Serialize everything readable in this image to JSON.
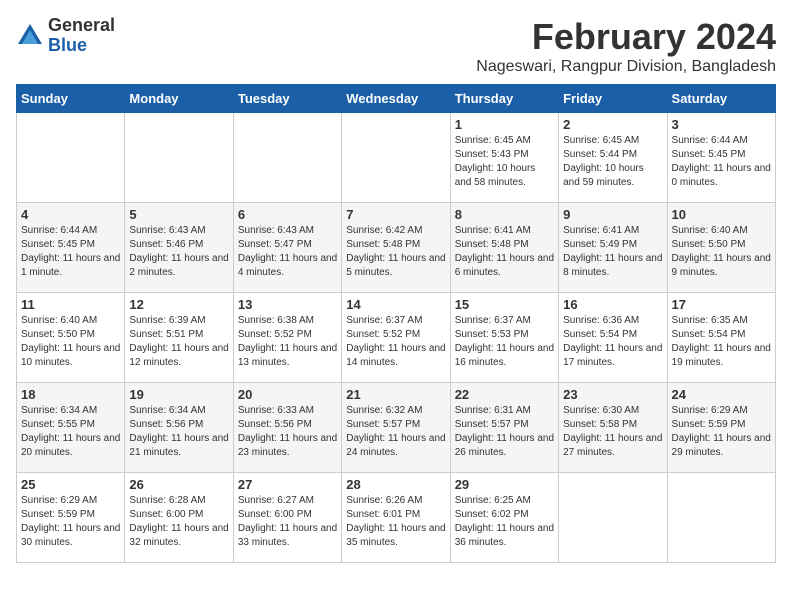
{
  "header": {
    "logo": {
      "general": "General",
      "blue": "Blue"
    },
    "title": "February 2024",
    "location": "Nageswari, Rangpur Division, Bangladesh"
  },
  "days_of_week": [
    "Sunday",
    "Monday",
    "Tuesday",
    "Wednesday",
    "Thursday",
    "Friday",
    "Saturday"
  ],
  "weeks": [
    [
      {
        "day": "",
        "info": ""
      },
      {
        "day": "",
        "info": ""
      },
      {
        "day": "",
        "info": ""
      },
      {
        "day": "",
        "info": ""
      },
      {
        "day": "1",
        "info": "Sunrise: 6:45 AM\nSunset: 5:43 PM\nDaylight: 10 hours and 58 minutes."
      },
      {
        "day": "2",
        "info": "Sunrise: 6:45 AM\nSunset: 5:44 PM\nDaylight: 10 hours and 59 minutes."
      },
      {
        "day": "3",
        "info": "Sunrise: 6:44 AM\nSunset: 5:45 PM\nDaylight: 11 hours and 0 minutes."
      }
    ],
    [
      {
        "day": "4",
        "info": "Sunrise: 6:44 AM\nSunset: 5:45 PM\nDaylight: 11 hours and 1 minute."
      },
      {
        "day": "5",
        "info": "Sunrise: 6:43 AM\nSunset: 5:46 PM\nDaylight: 11 hours and 2 minutes."
      },
      {
        "day": "6",
        "info": "Sunrise: 6:43 AM\nSunset: 5:47 PM\nDaylight: 11 hours and 4 minutes."
      },
      {
        "day": "7",
        "info": "Sunrise: 6:42 AM\nSunset: 5:48 PM\nDaylight: 11 hours and 5 minutes."
      },
      {
        "day": "8",
        "info": "Sunrise: 6:41 AM\nSunset: 5:48 PM\nDaylight: 11 hours and 6 minutes."
      },
      {
        "day": "9",
        "info": "Sunrise: 6:41 AM\nSunset: 5:49 PM\nDaylight: 11 hours and 8 minutes."
      },
      {
        "day": "10",
        "info": "Sunrise: 6:40 AM\nSunset: 5:50 PM\nDaylight: 11 hours and 9 minutes."
      }
    ],
    [
      {
        "day": "11",
        "info": "Sunrise: 6:40 AM\nSunset: 5:50 PM\nDaylight: 11 hours and 10 minutes."
      },
      {
        "day": "12",
        "info": "Sunrise: 6:39 AM\nSunset: 5:51 PM\nDaylight: 11 hours and 12 minutes."
      },
      {
        "day": "13",
        "info": "Sunrise: 6:38 AM\nSunset: 5:52 PM\nDaylight: 11 hours and 13 minutes."
      },
      {
        "day": "14",
        "info": "Sunrise: 6:37 AM\nSunset: 5:52 PM\nDaylight: 11 hours and 14 minutes."
      },
      {
        "day": "15",
        "info": "Sunrise: 6:37 AM\nSunset: 5:53 PM\nDaylight: 11 hours and 16 minutes."
      },
      {
        "day": "16",
        "info": "Sunrise: 6:36 AM\nSunset: 5:54 PM\nDaylight: 11 hours and 17 minutes."
      },
      {
        "day": "17",
        "info": "Sunrise: 6:35 AM\nSunset: 5:54 PM\nDaylight: 11 hours and 19 minutes."
      }
    ],
    [
      {
        "day": "18",
        "info": "Sunrise: 6:34 AM\nSunset: 5:55 PM\nDaylight: 11 hours and 20 minutes."
      },
      {
        "day": "19",
        "info": "Sunrise: 6:34 AM\nSunset: 5:56 PM\nDaylight: 11 hours and 21 minutes."
      },
      {
        "day": "20",
        "info": "Sunrise: 6:33 AM\nSunset: 5:56 PM\nDaylight: 11 hours and 23 minutes."
      },
      {
        "day": "21",
        "info": "Sunrise: 6:32 AM\nSunset: 5:57 PM\nDaylight: 11 hours and 24 minutes."
      },
      {
        "day": "22",
        "info": "Sunrise: 6:31 AM\nSunset: 5:57 PM\nDaylight: 11 hours and 26 minutes."
      },
      {
        "day": "23",
        "info": "Sunrise: 6:30 AM\nSunset: 5:58 PM\nDaylight: 11 hours and 27 minutes."
      },
      {
        "day": "24",
        "info": "Sunrise: 6:29 AM\nSunset: 5:59 PM\nDaylight: 11 hours and 29 minutes."
      }
    ],
    [
      {
        "day": "25",
        "info": "Sunrise: 6:29 AM\nSunset: 5:59 PM\nDaylight: 11 hours and 30 minutes."
      },
      {
        "day": "26",
        "info": "Sunrise: 6:28 AM\nSunset: 6:00 PM\nDaylight: 11 hours and 32 minutes."
      },
      {
        "day": "27",
        "info": "Sunrise: 6:27 AM\nSunset: 6:00 PM\nDaylight: 11 hours and 33 minutes."
      },
      {
        "day": "28",
        "info": "Sunrise: 6:26 AM\nSunset: 6:01 PM\nDaylight: 11 hours and 35 minutes."
      },
      {
        "day": "29",
        "info": "Sunrise: 6:25 AM\nSunset: 6:02 PM\nDaylight: 11 hours and 36 minutes."
      },
      {
        "day": "",
        "info": ""
      },
      {
        "day": "",
        "info": ""
      }
    ]
  ]
}
